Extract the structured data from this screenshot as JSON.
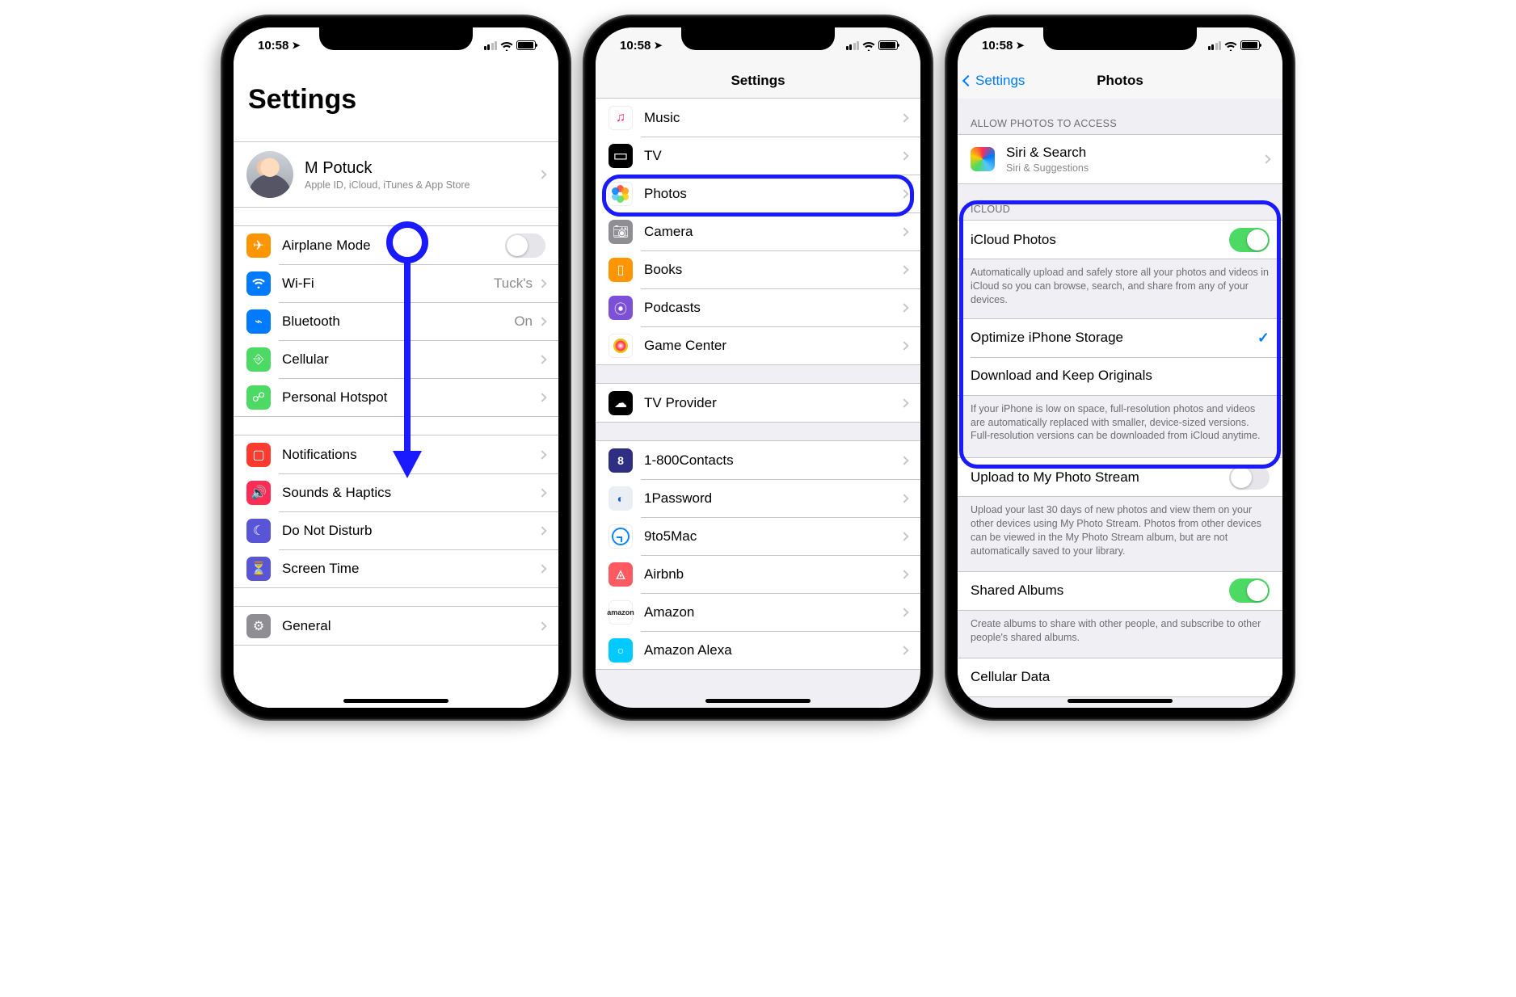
{
  "statusbar": {
    "time": "10:58"
  },
  "screen1": {
    "title": "Settings",
    "profile": {
      "name": "M Potuck",
      "sub": "Apple ID, iCloud, iTunes & App Store"
    },
    "rows": {
      "airplane": "Airplane Mode",
      "wifi": "Wi-Fi",
      "wifi_val": "Tuck's",
      "bt": "Bluetooth",
      "bt_val": "On",
      "cell": "Cellular",
      "hs": "Personal Hotspot",
      "notif": "Notifications",
      "sound": "Sounds & Haptics",
      "dnd": "Do Not Disturb",
      "screen": "Screen Time",
      "gen": "General"
    }
  },
  "screen2": {
    "title": "Settings",
    "rows": {
      "music": "Music",
      "tv": "TV",
      "photos": "Photos",
      "camera": "Camera",
      "books": "Books",
      "podcasts": "Podcasts",
      "gc": "Game Center",
      "tvp": "TV Provider",
      "c1": "1-800Contacts",
      "c2": "1Password",
      "c3": "9to5Mac",
      "c4": "Airbnb",
      "c5": "Amazon",
      "c6": "Amazon Alexa"
    }
  },
  "screen3": {
    "back": "Settings",
    "title": "Photos",
    "h1": "ALLOW PHOTOS TO ACCESS",
    "siri": "Siri & Search",
    "siri_sub": "Siri & Suggestions",
    "h2": "ICLOUD",
    "icloud_photos": "iCloud Photos",
    "icloud_footer": "Automatically upload and safely store all your photos and videos in iCloud so you can browse, search, and share from any of your devices.",
    "opt": "Optimize iPhone Storage",
    "dl": "Download and Keep Originals",
    "storage_footer": "If your iPhone is low on space, full-resolution photos and videos are automatically replaced with smaller, device-sized versions. Full-resolution versions can be downloaded from iCloud anytime.",
    "stream": "Upload to My Photo Stream",
    "stream_footer": "Upload your last 30 days of new photos and view them on your other devices using My Photo Stream. Photos from other devices can be viewed in the My Photo Stream album, but are not automatically saved to your library.",
    "shared": "Shared Albums",
    "shared_footer": "Create albums to share with other people, and subscribe to other people's shared albums.",
    "celldata": "Cellular Data"
  }
}
